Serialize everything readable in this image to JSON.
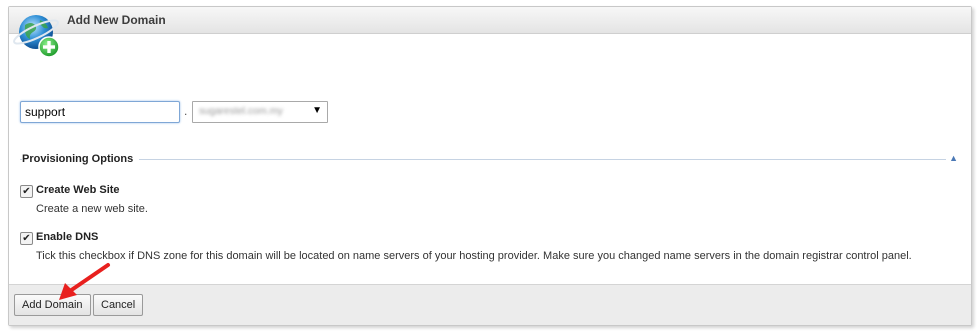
{
  "panel": {
    "title": "Add New Domain",
    "icon": "globe-add-icon"
  },
  "domain": {
    "subdomain_value": "support",
    "separator": ".",
    "selected_domain": "sugarestel.com.my"
  },
  "provisioning": {
    "title": "Provisioning Options",
    "options": [
      {
        "label": "Create Web Site",
        "checked": true,
        "description": "Create a new web site."
      },
      {
        "label": "Enable DNS",
        "checked": true,
        "description": "Tick this checkbox if DNS zone for this domain will be located on name servers of your hosting provider. Make sure you changed name servers in the domain registrar control panel."
      }
    ]
  },
  "buttons": {
    "add_label": "Add Domain",
    "cancel_label": "Cancel"
  },
  "colors": {
    "annotation_arrow": "#e8201e",
    "accent": "#4a78b5"
  }
}
